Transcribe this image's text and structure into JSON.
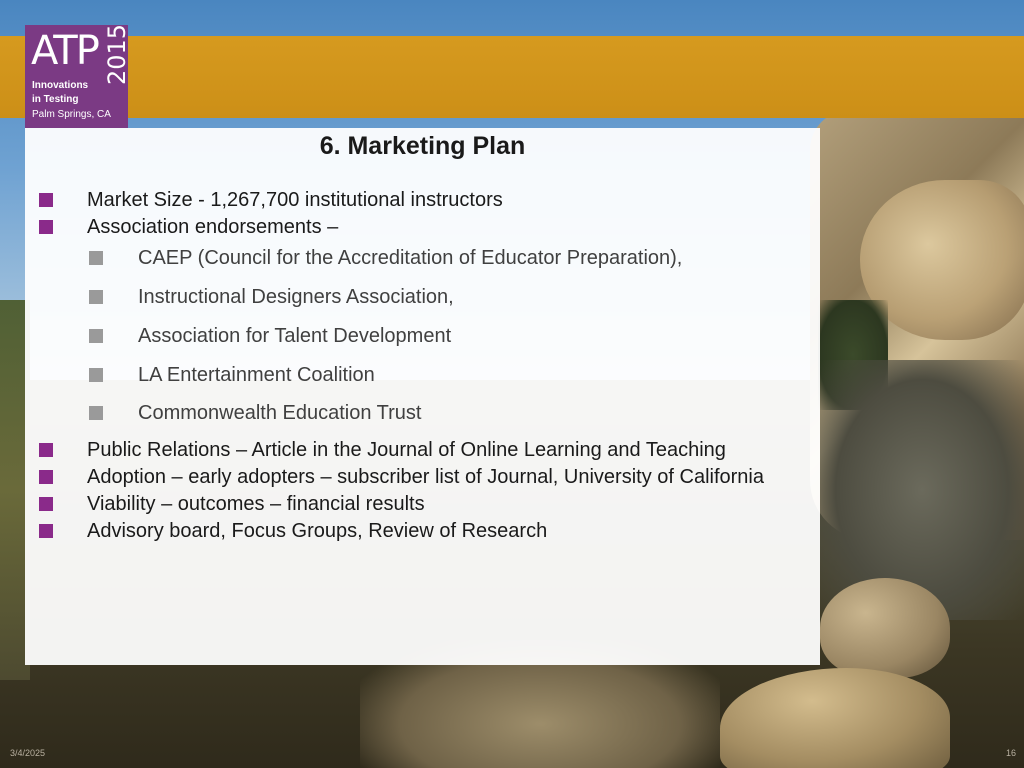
{
  "logo": {
    "brand": "ATP",
    "year": "2015",
    "line1": "Innovations",
    "line2": "in Testing",
    "line3": "Palm Springs, CA"
  },
  "slide": {
    "title": "6. Marketing Plan",
    "bullets": [
      {
        "level": 1,
        "text": "Market Size - 1,267,700 institutional instructors"
      },
      {
        "level": 1,
        "text": "Association endorsements –"
      },
      {
        "level": 2,
        "text": "CAEP (Council for the Accreditation of Educator Preparation),"
      },
      {
        "level": 2,
        "text": "Instructional Designers Association,"
      },
      {
        "level": 2,
        "text": "Association for Talent Development"
      },
      {
        "level": 2,
        "text": "LA Entertainment Coalition"
      },
      {
        "level": 2,
        "text": "Commonwealth Education Trust"
      },
      {
        "level": 1,
        "text": "Public Relations – Article in the Journal of Online Learning and Teaching"
      },
      {
        "level": 1,
        "text": "Adoption – early adopters – subscriber list of Journal, University of California"
      },
      {
        "level": 1,
        "text": "Viability – outcomes – financial results"
      },
      {
        "level": 1,
        "text": "Advisory board, Focus Groups, Review of Research"
      }
    ]
  },
  "footer": {
    "date": "3/4/2025",
    "page_number": "16"
  },
  "colors": {
    "header_bar": "#d69a1f",
    "logo_bg": "#7b3a84",
    "bullet_level1": "#8a2a8a",
    "bullet_level2": "#9a9a9a"
  }
}
